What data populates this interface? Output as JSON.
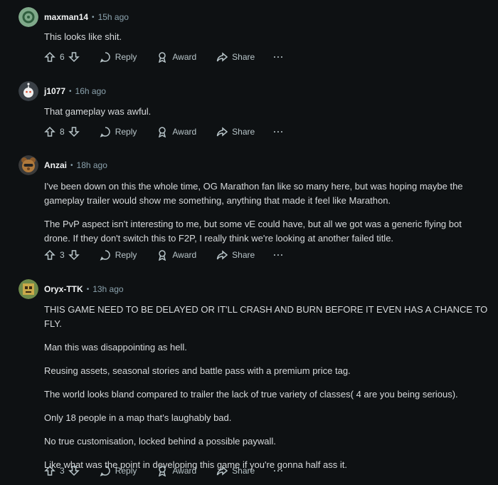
{
  "comments": [
    {
      "username": "maxman14",
      "time": "15h ago",
      "paragraphs": [
        "This looks like shit."
      ],
      "votes": "6"
    },
    {
      "username": "j1077",
      "time": "16h ago",
      "paragraphs": [
        "That gameplay was awful."
      ],
      "votes": "8"
    },
    {
      "username": "Anzai",
      "time": "18h ago",
      "paragraphs": [
        "I've been down on this the whole time, OG Marathon fan like so many here, but was hoping maybe the gameplay trailer would show me something, anything that made it feel like Marathon.",
        "The PvP aspect isn't interesting to me, but some vE could have, but all we got was a generic flying bot drone. If they don't switch this to F2P, I really think we're looking at another failed title."
      ],
      "votes": "3"
    },
    {
      "username": "Oryx-TTK",
      "time": "13h ago",
      "paragraphs": [
        "THIS GAME NEED TO BE DELAYED OR IT'LL CRASH AND BURN BEFORE IT EVEN HAS A CHANCE TO FLY.",
        "Man this was disappointing as hell.",
        "Reusing assets, seasonal stories and battle pass with a premium price tag.",
        "The world looks bland compared to trailer the lack of true variety of classes( 4 are you being serious).",
        "Only 18 people in a map that's laughably bad.",
        "No true customisation, locked behind a possible paywall.",
        "Like what was the point in developing this game if you're gonna half ass it."
      ],
      "votes": "3"
    }
  ],
  "labels": {
    "separator": "•",
    "reply": "Reply",
    "award": "Award",
    "share": "Share",
    "more": "···"
  },
  "colors": {
    "background": "#0e1113",
    "text": "#d7dadc",
    "muted": "#8ba2ad"
  }
}
